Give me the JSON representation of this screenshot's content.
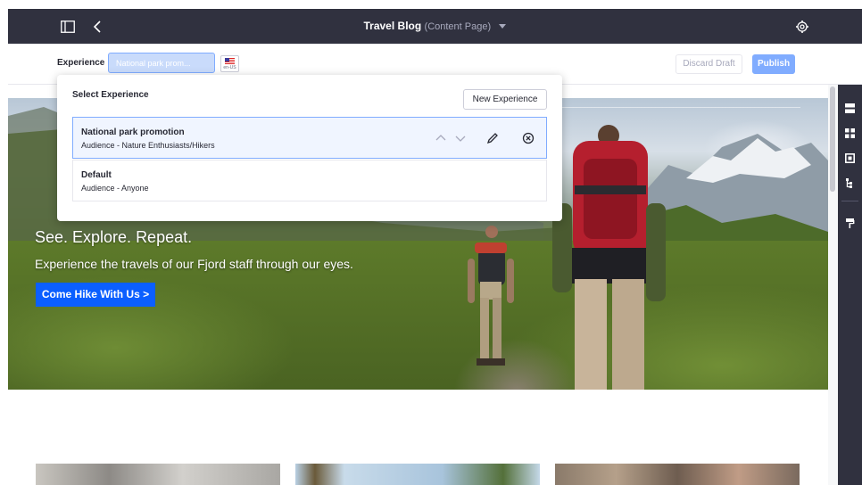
{
  "topbar": {
    "title": "Travel Blog",
    "subtitle": "(Content Page)",
    "icons": [
      "sidebar-toggle-icon",
      "back-chevron-icon",
      "gear-icon"
    ]
  },
  "toolbar": {
    "experience_label": "Experience",
    "experience_value": "National park prom...",
    "locale": "en-US",
    "discard_label": "Discard Draft",
    "publish_label": "Publish"
  },
  "dropdown": {
    "title": "Select Experience",
    "new_button": "New Experience",
    "items": [
      {
        "name": "National park promotion",
        "audience": "Audience - Nature Enthusiasts/Hikers"
      },
      {
        "name": "Default",
        "audience": "Audience - Anyone"
      }
    ]
  },
  "hero": {
    "title": "See. Explore. Repeat.",
    "subtitle": "Experience the travels of our Fjord staff through our eyes.",
    "cta": "Come Hike With Us >"
  },
  "colors": {
    "topbar": "#30313f",
    "accent": "#0b5fff",
    "publish": "#80acff"
  }
}
